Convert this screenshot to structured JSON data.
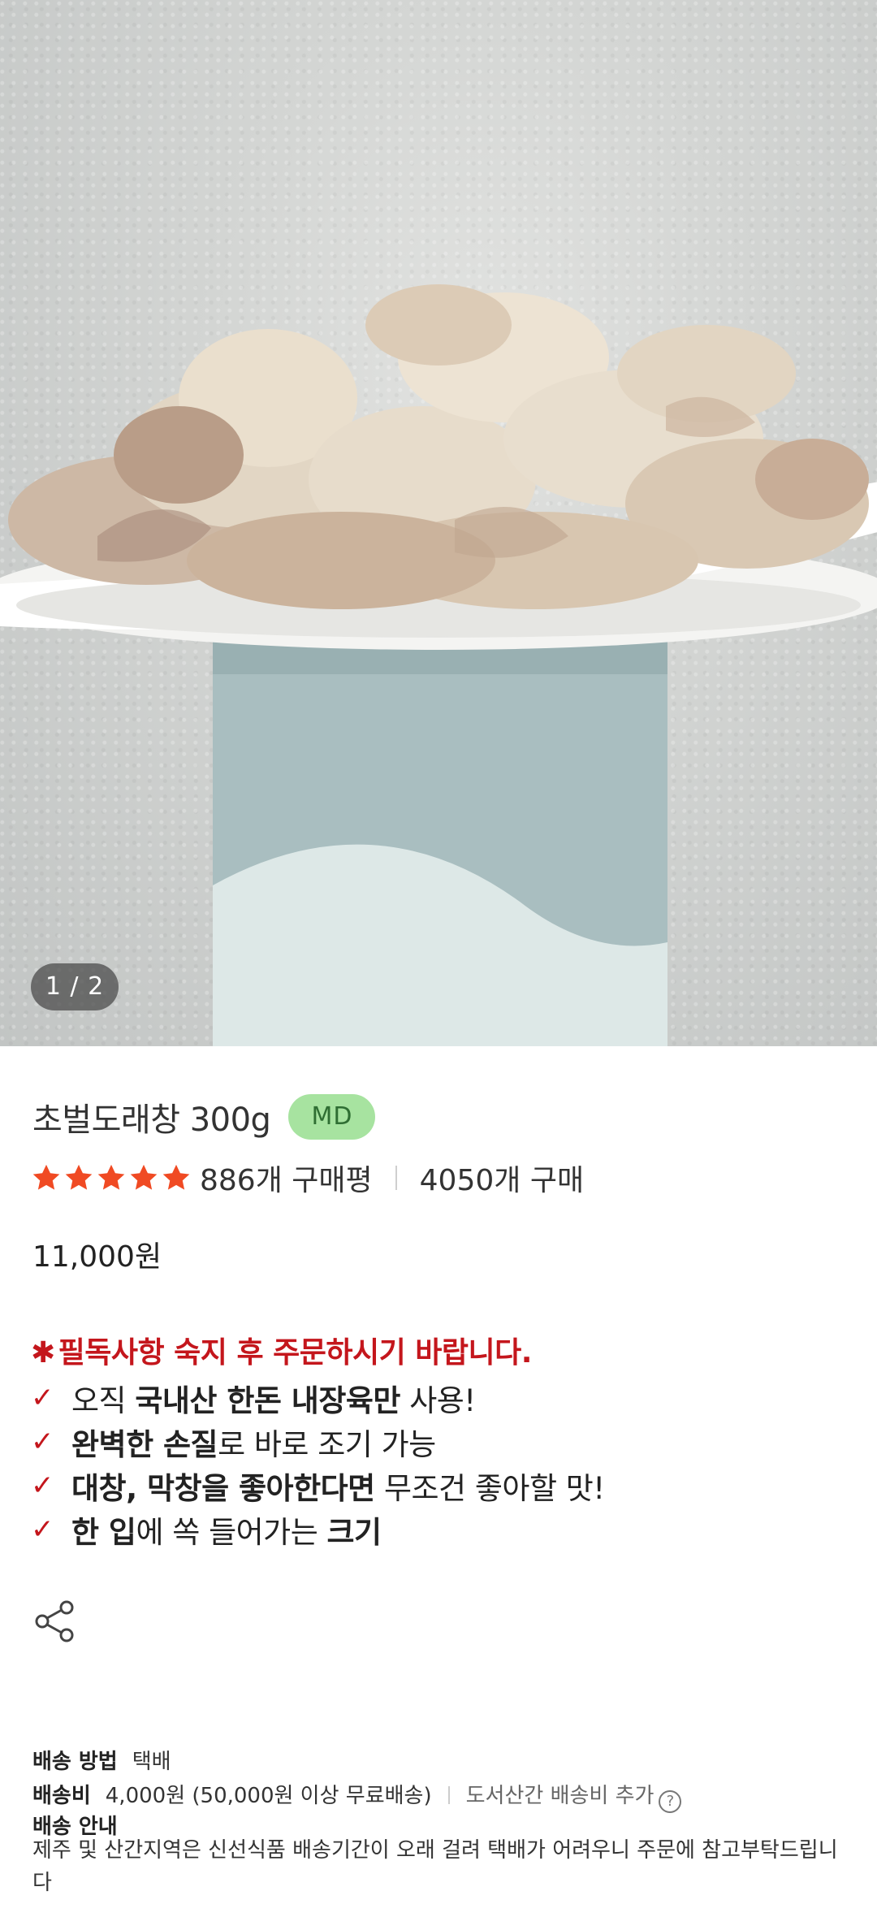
{
  "hero": {
    "pager": "1 / 2"
  },
  "product": {
    "title": "초벌도래창 300g",
    "badge": "MD",
    "rating_stars": 5,
    "review_count": "886개 구매평",
    "purchase_count": "4050개 구매",
    "price": "11,000원"
  },
  "notice": {
    "asterisk": "✱",
    "text": "필독사항 숙지 후 주문하시기 바랍니다."
  },
  "features": [
    {
      "check": "✓",
      "before": "오직 ",
      "bold": "국내산 한돈 내장육만",
      "after": " 사용!"
    },
    {
      "check": "✓",
      "before": "",
      "bold": "완벽한 손질",
      "after": "로 바로 조기 가능"
    },
    {
      "check": "✓",
      "before": "",
      "bold": "대창, 막창을 좋아한다면",
      "after": " 무조건 좋아할 맛!"
    },
    {
      "check": "✓",
      "before": "",
      "bold": "한 입",
      "after": "에 쏙 들어가는 ",
      "bold2": "크기"
    }
  ],
  "shipping": {
    "method_label": "배송 방법",
    "method_value": "택배",
    "fee_label": "배송비",
    "fee_value": "4,000원 (50,000원 이상 무료배송)",
    "extra": "도서산간 배송비 추가",
    "help_icon": "?",
    "guide_label": "배송 안내",
    "guide_text": "제주 및 산간지역은 신선식품 배송기간이 오래 걸려 택배가 어려우니 주문에 참고부탁드립니다"
  },
  "colors": {
    "accent_red": "#c4161c",
    "star": "#f04a23",
    "badge_bg": "#a7e3a0",
    "badge_text": "#2f6e33"
  },
  "icons": [
    "star-icon",
    "share-icon",
    "help-icon",
    "check-icon"
  ]
}
